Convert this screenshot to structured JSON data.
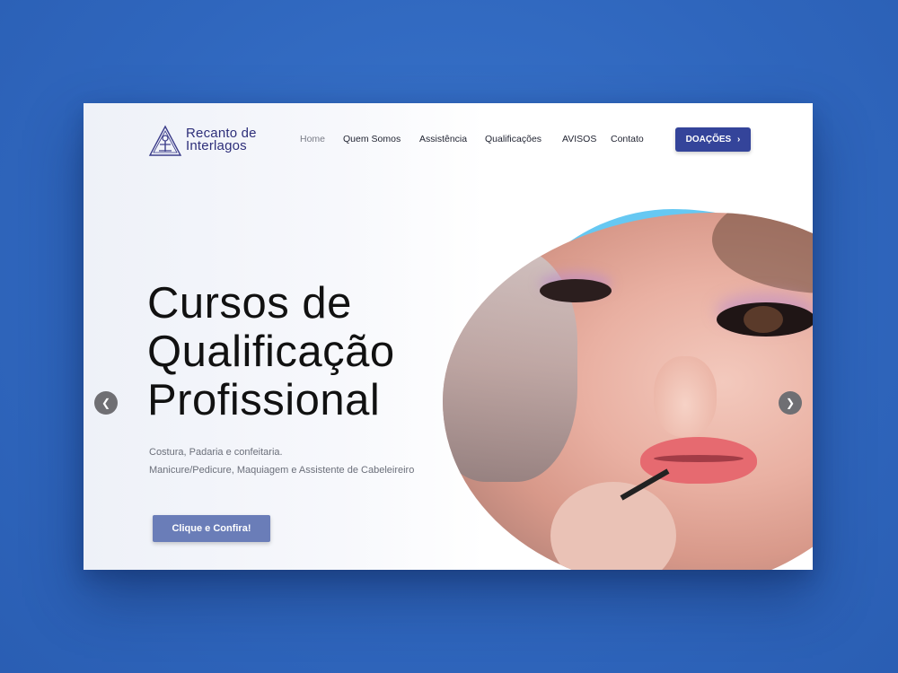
{
  "site": {
    "logo_line1": "Recanto de",
    "logo_line2": "Interlagos"
  },
  "nav": {
    "items": [
      {
        "label": "Home"
      },
      {
        "label": "Quem Somos"
      },
      {
        "label": "Assistência"
      },
      {
        "label": "Qualificações"
      },
      {
        "label": "AVISOS"
      },
      {
        "label": "Contato"
      }
    ],
    "donate_label": "DOAÇÕES",
    "donate_icon": "chevron-right-icon"
  },
  "hero": {
    "title_line1": "Cursos de",
    "title_line2": "Qualificação",
    "title_line3": "Profissional",
    "subtitle_line1": "Costura, Padaria e confeitaria.",
    "subtitle_line2": "Manicure/Pedicure, Maquiagem e Assistente de Cabeleireiro",
    "cta_label": "Clique e Confira!"
  },
  "slider": {
    "prev_icon": "chevron-left-icon",
    "next_icon": "chevron-right-icon"
  },
  "colors": {
    "page_background": "#3068bf",
    "brand": "#2e2f7a",
    "donate_button": "#34449a",
    "cta_button": "#6a7db8",
    "accent_blob": "#66c8f2"
  }
}
